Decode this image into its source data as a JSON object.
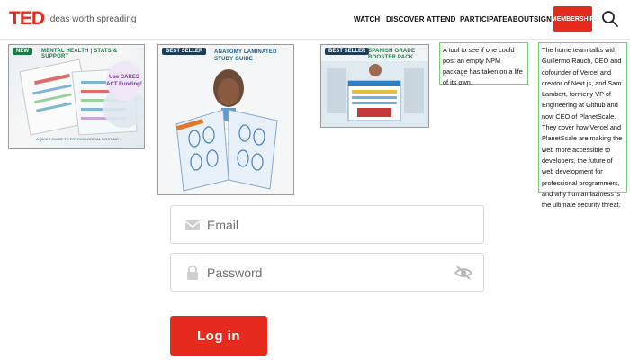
{
  "header": {
    "logo": "TED",
    "tagline": "Ideas worth spreading",
    "nav": [
      "WATCH",
      "DISCOVER",
      "ATTEND",
      "PARTICIPATE",
      "ABOUT",
      "SIGN IN"
    ],
    "membership_label": "MEMBERSHIP",
    "search_icon": "search-icon"
  },
  "ads": [
    {
      "badge": "NEW",
      "title": "MENTAL HEALTH | STATS & SUPPORT",
      "callout": "Use CARES ACT Funding!",
      "footer": "A QUICK GUIDE TO PSYCHOLOGICAL FIRST AID"
    },
    {
      "badge": "BEST SELLER",
      "title": "ANATOMY LAMINATED STUDY GUIDE"
    },
    {
      "badge": "BEST SELLER",
      "title": "SPANISH GRADE BOOSTER PACK"
    }
  ],
  "notes": [
    "A tool to see if one could post an empty NPM package has taken on a life of its own.",
    "The home team talks with Guillermo Rauch, CEO and cofounder of Vercel and creator of Next.js, and Sam Lambert, formerly VP of Engineering at Github and now CEO of PlanetScale. They cover how Vercel and PlanetScale are making the web more accessible to developers, the future of web development for professional programmers, and why human laziness is the ultimate security threat."
  ],
  "form": {
    "email_placeholder": "Email",
    "password_placeholder": "Password",
    "login_label": "Log in"
  },
  "colors": {
    "brand_red": "#e62b1e",
    "badge_green": "#1e7b46",
    "note_border": "#7ec87e"
  }
}
